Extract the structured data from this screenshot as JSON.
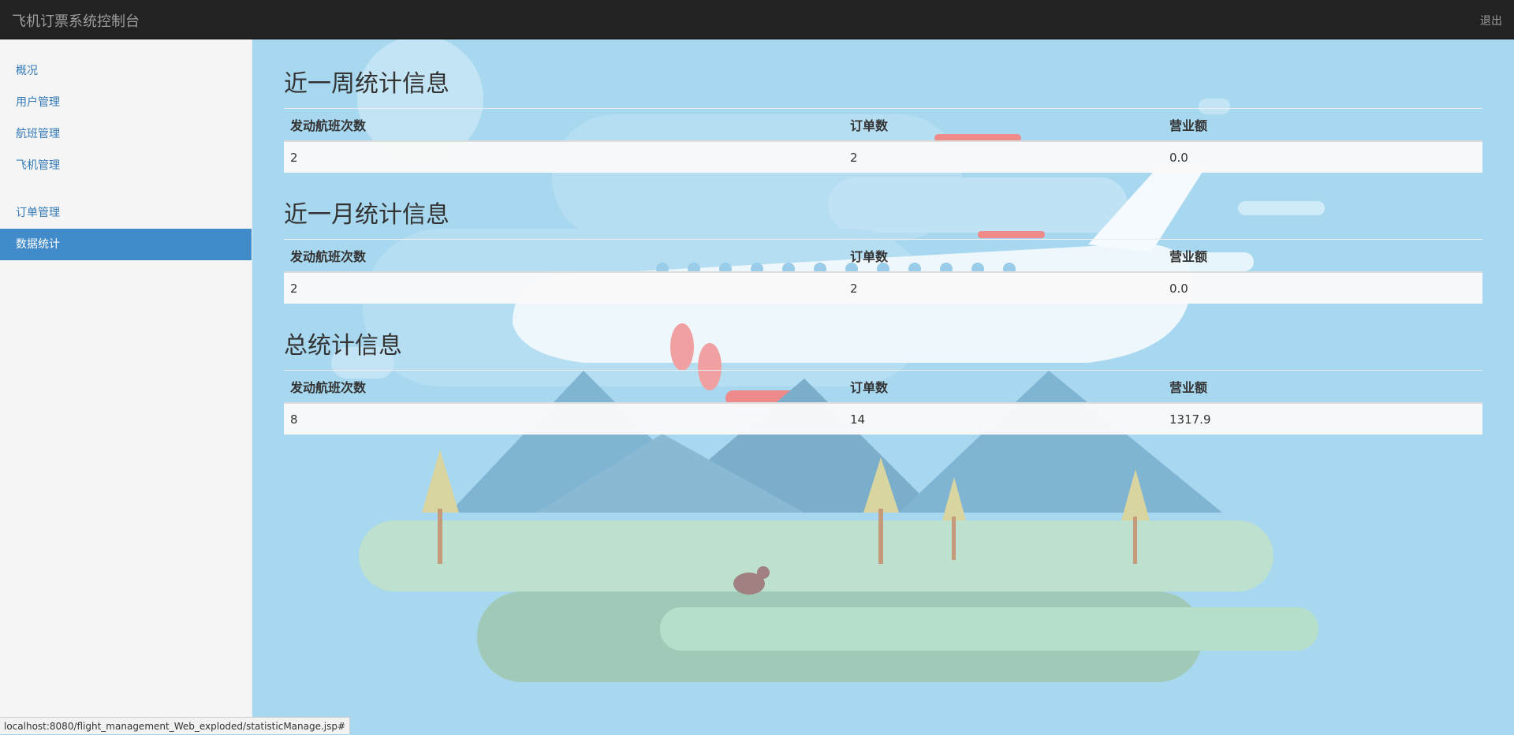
{
  "navbar": {
    "brand": "飞机订票系统控制台",
    "logout": "退出"
  },
  "sidebar": {
    "group1": [
      {
        "label": "概况"
      },
      {
        "label": "用户管理"
      },
      {
        "label": "航班管理"
      },
      {
        "label": "飞机管理"
      }
    ],
    "group2": [
      {
        "label": "订单管理"
      },
      {
        "label": "数据统计",
        "active": true
      }
    ]
  },
  "sections": [
    {
      "title": "近一周统计信息",
      "headers": [
        "发动航班次数",
        "订单数",
        "营业额"
      ],
      "row": [
        "2",
        "2",
        "0.0"
      ]
    },
    {
      "title": "近一月统计信息",
      "headers": [
        "发动航班次数",
        "订单数",
        "营业额"
      ],
      "row": [
        "2",
        "2",
        "0.0"
      ]
    },
    {
      "title": "总统计信息",
      "headers": [
        "发动航班次数",
        "订单数",
        "营业额"
      ],
      "row": [
        "8",
        "14",
        "1317.9"
      ]
    }
  ],
  "statusbar": {
    "url": "localhost:8080/flight_management_Web_exploded/statisticManage.jsp#"
  },
  "colors": {
    "navbar_bg": "#222222",
    "sidebar_active": "#428bca",
    "background_sky": "#a8d8f0"
  }
}
